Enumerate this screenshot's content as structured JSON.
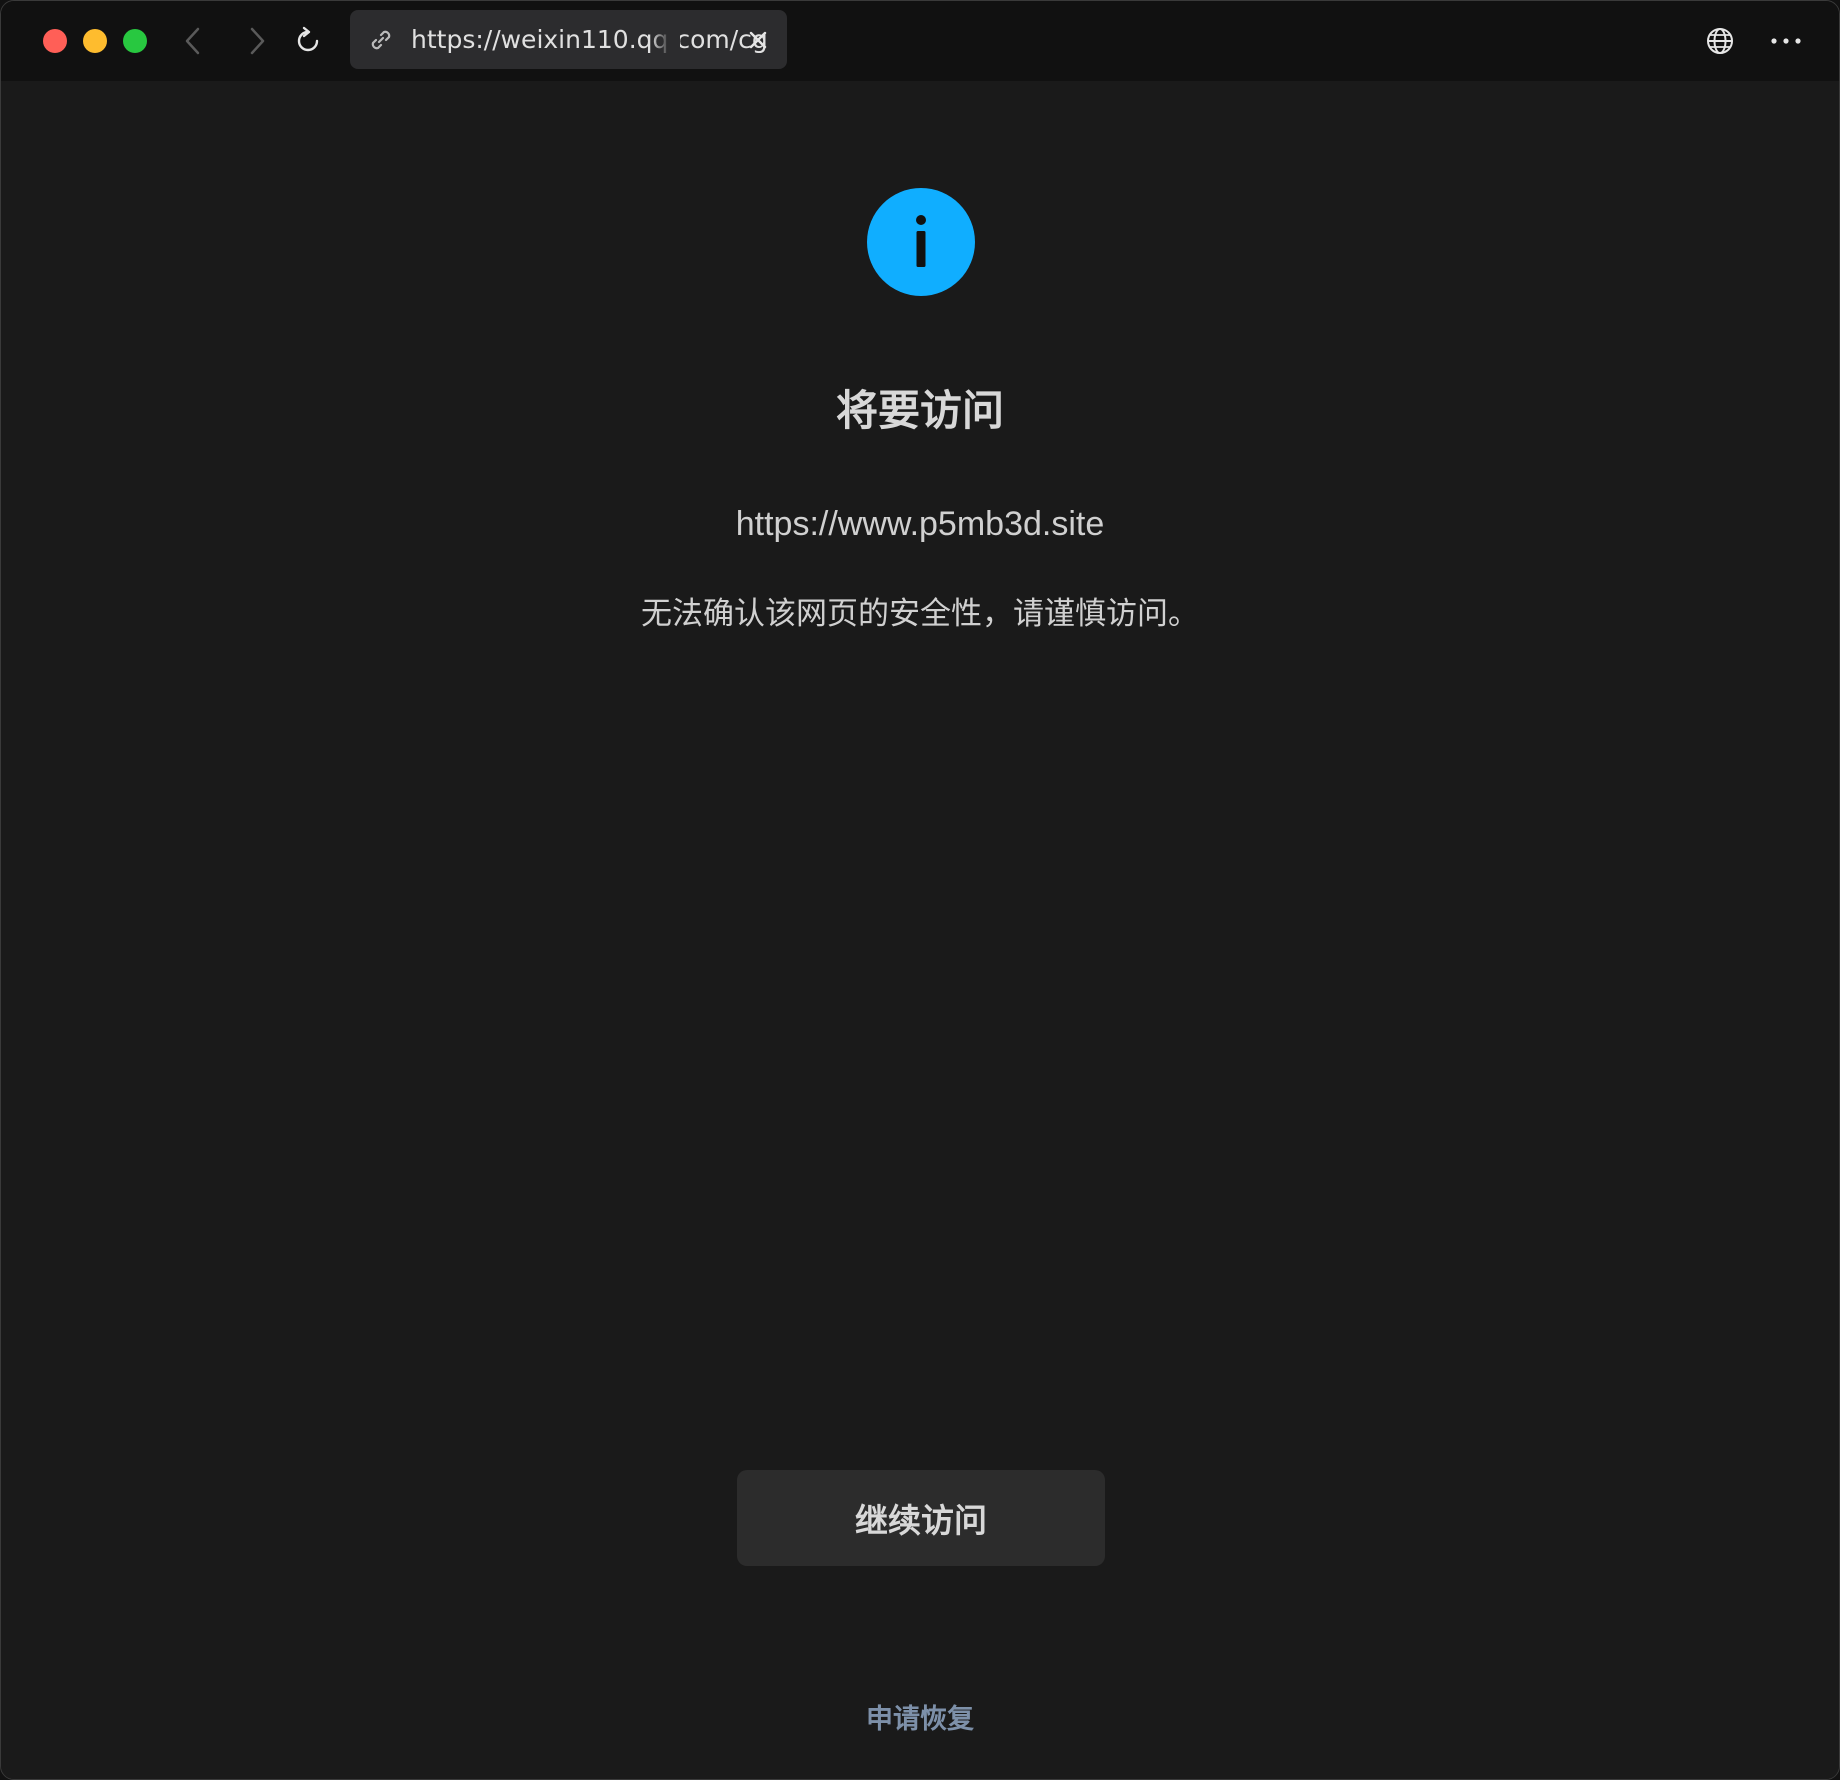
{
  "browser": {
    "tab_url": "https://weixin110.qq.com/cg",
    "icons": {
      "link": "link-icon",
      "close": "close-icon",
      "back": "chevron-left-icon",
      "forward": "chevron-right-icon",
      "reload": "reload-icon",
      "language": "globe-icon",
      "more": "more-horizontal-icon"
    },
    "traffic_lights": {
      "close_color": "#ff5f57",
      "minimize_color": "#febc2e",
      "maximize_color": "#28c840"
    }
  },
  "page": {
    "status_icon": "info-icon",
    "title": "将要访问",
    "target_url": "https://www.p5mb3d.site",
    "warning": "无法确认该网页的安全性，请谨慎访问。",
    "continue_label": "继续访问",
    "appeal_label": "申请恢复"
  },
  "colors": {
    "info_accent": "#10aeff",
    "link_color": "#7d90a9",
    "background": "#1a1a1a"
  }
}
